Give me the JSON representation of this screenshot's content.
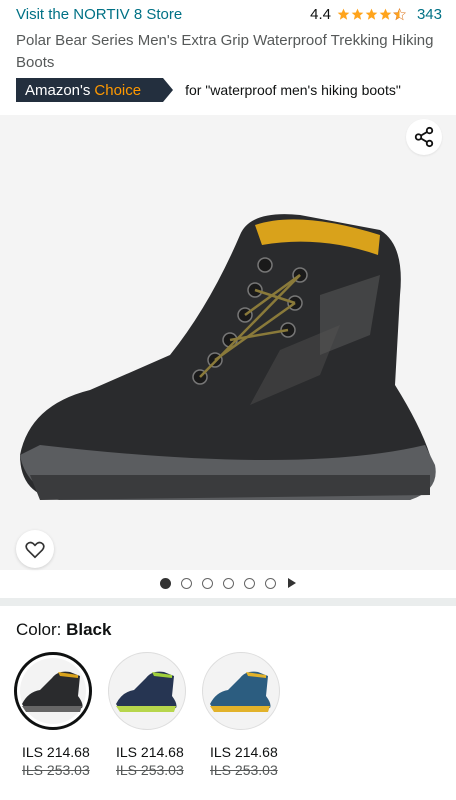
{
  "store": {
    "link_text": "Visit the NORTIV 8 Store"
  },
  "rating": {
    "value": "4.4",
    "count": "343",
    "stars": 4.5
  },
  "product": {
    "title": "Polar Bear Series Men's Extra Grip Waterproof Trekking Hiking Boots"
  },
  "badge": {
    "prefix": "Amazon's",
    "accent": "Choice",
    "query": "for \"waterproof men's hiking boots\"",
    "bg_color": "#232f3e",
    "accent_color": "#ff9900"
  },
  "gallery": {
    "image_count": 6,
    "active_index": 0
  },
  "color": {
    "label": "Color:",
    "selected": "Black"
  },
  "variants": [
    {
      "name": "Black",
      "price": "ILS 214.68",
      "old_price": "ILS 253.03"
    },
    {
      "name": "Navy/Green",
      "price": "ILS 214.68",
      "old_price": "ILS 253.03"
    },
    {
      "name": "Blue/Yellow",
      "price": "ILS 214.68",
      "old_price": "ILS 253.03"
    }
  ]
}
